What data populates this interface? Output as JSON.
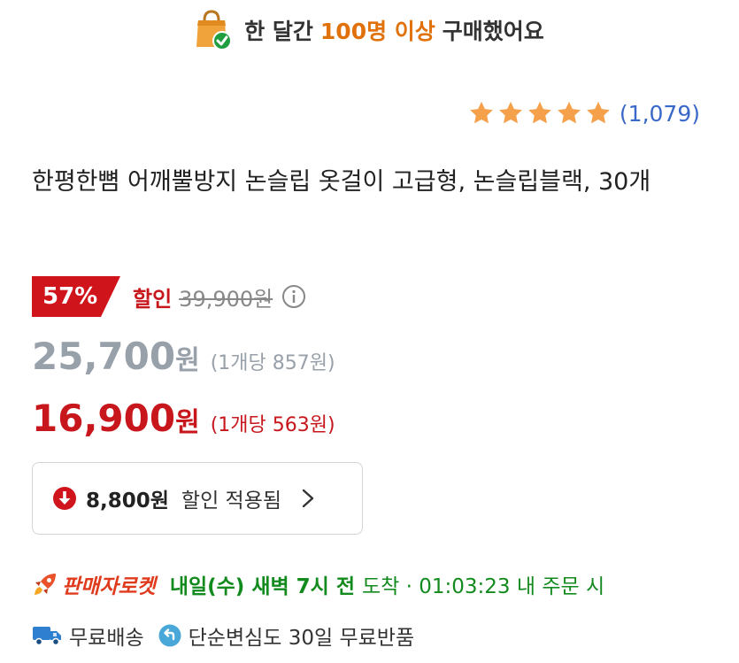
{
  "banner": {
    "prefix": "한 달간",
    "highlight": "100명 이상",
    "suffix": "구매했어요"
  },
  "rating": {
    "stars": 5,
    "review_count": "(1,079)"
  },
  "product": {
    "title": "한평한뼘 어깨뿔방지 논슬립 옷걸이 고급형, 논슬립블랙, 30개"
  },
  "pricing": {
    "discount_badge": "57%",
    "discount_label": "할인",
    "original_price": "39,900원",
    "list_price": "25,700",
    "list_price_currency": "원",
    "list_unit_price": "(1개당 857원)",
    "final_price": "16,900",
    "final_price_currency": "원",
    "final_unit_price": "(1개당 563원)"
  },
  "coupon": {
    "amount": "8,800원",
    "text": "할인 적용됨"
  },
  "delivery": {
    "brand": "판매자로켓",
    "eta": "내일(수) 새벽 7시 전",
    "detail": "도착 · 01:03:23 내 주문 시"
  },
  "shipping": {
    "free_shipping": "무료배송",
    "return_policy": "단순변심도 30일 무료반품"
  },
  "colors": {
    "accent_red": "#c8161d",
    "badge_red": "#d0141b",
    "highlight_orange": "#e0710b",
    "delivery_green": "#138a1e",
    "star_orange": "#f5a04a",
    "link_blue": "#3a68c8"
  },
  "icons": [
    "shopping-bag-check-icon",
    "star-icon",
    "info-icon",
    "arrow-down-circle-icon",
    "chevron-right-icon",
    "rocket-icon",
    "truck-icon",
    "return-icon"
  ]
}
